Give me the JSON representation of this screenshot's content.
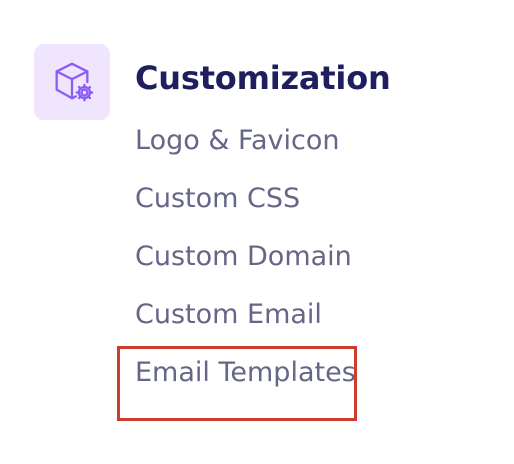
{
  "section": {
    "icon": "cube-gear-icon",
    "title": "Customization",
    "accent_color": "#efe6fd",
    "icon_color": "#8b5cf6",
    "title_color": "#1f1f5e"
  },
  "menu": {
    "items": [
      {
        "label": "Logo & Favicon"
      },
      {
        "label": "Custom CSS"
      },
      {
        "label": "Custom Domain"
      },
      {
        "label": "Custom Email"
      },
      {
        "label": "Email Templates"
      }
    ],
    "text_color": "#666688"
  },
  "highlight": {
    "target": "Email Templates",
    "color": "#cc3e2b"
  }
}
